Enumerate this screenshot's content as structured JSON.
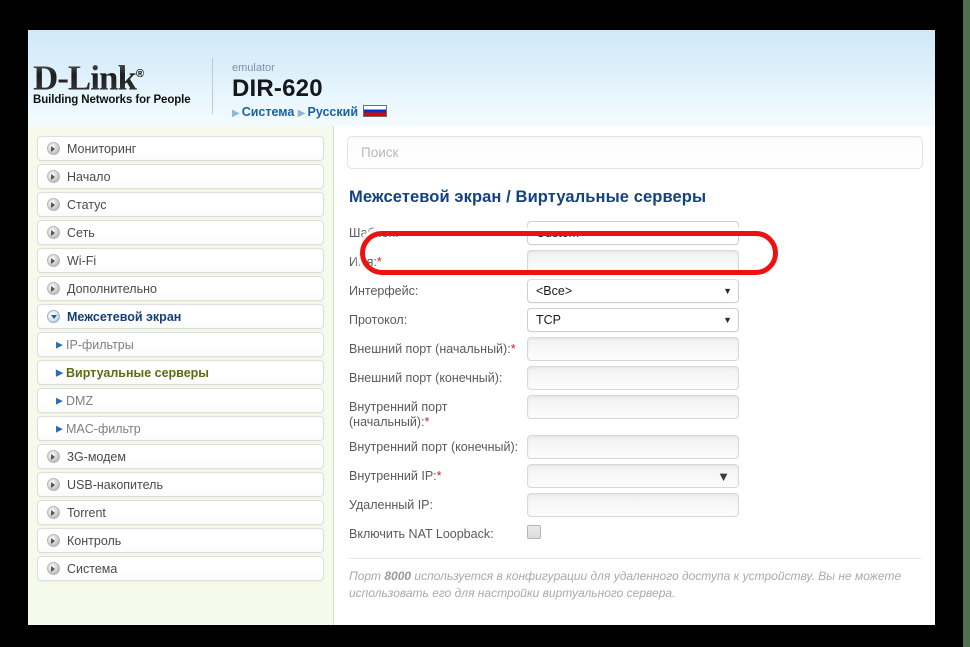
{
  "colors": {
    "accent_blue": "#13427d",
    "highlight_red": "#ee1111",
    "sidebar_bg": "#f6faea",
    "active_green": "#5a6d12",
    "right_edge": "#4d7050"
  },
  "header": {
    "brand": "D-Link",
    "brand_reg": "®",
    "tagline": "Building Networks for People",
    "emulator_label": "emulator",
    "model": "DIR-620",
    "breadcrumbs": [
      {
        "label": "Система"
      },
      {
        "label": "Русский"
      }
    ],
    "flag_name": "ru-flag"
  },
  "sidebar": {
    "items": [
      {
        "label": "Мониторинг",
        "type": "top"
      },
      {
        "label": "Начало",
        "type": "top"
      },
      {
        "label": "Статус",
        "type": "top"
      },
      {
        "label": "Сеть",
        "type": "top"
      },
      {
        "label": "Wi-Fi",
        "type": "top"
      },
      {
        "label": "Дополнительно",
        "type": "top"
      },
      {
        "label": "Межсетевой экран",
        "type": "top-expanded"
      },
      {
        "label": "IP-фильтры",
        "type": "sub"
      },
      {
        "label": "Виртуальные серверы",
        "type": "sub-active"
      },
      {
        "label": "DMZ",
        "type": "sub"
      },
      {
        "label": "MAC-фильтр",
        "type": "sub"
      },
      {
        "label": "3G-модем",
        "type": "top"
      },
      {
        "label": "USB-накопитель",
        "type": "top"
      },
      {
        "label": "Torrent",
        "type": "top"
      },
      {
        "label": "Контроль",
        "type": "top"
      },
      {
        "label": "Система",
        "type": "top"
      }
    ]
  },
  "search": {
    "placeholder": "Поиск",
    "value": ""
  },
  "main": {
    "title": "Межсетевой экран /  Виртуальные серверы",
    "fields": [
      {
        "label": "Шаблон:",
        "required": false,
        "control": "select",
        "value": "Custom"
      },
      {
        "label": "Имя:",
        "required": true,
        "control": "text",
        "value": ""
      },
      {
        "label": "Интерфейс:",
        "required": false,
        "control": "select",
        "value": "<Все>"
      },
      {
        "label": "Протокол:",
        "required": false,
        "control": "select",
        "value": "TCP"
      },
      {
        "label": "Внешний порт (начальный):",
        "required": true,
        "control": "text",
        "value": ""
      },
      {
        "label": "Внешний порт (конечный):",
        "required": false,
        "control": "text",
        "value": ""
      },
      {
        "label": "Внутренний порт (начальный):",
        "required": true,
        "control": "text",
        "value": ""
      },
      {
        "label": "Внутренний порт (конечный):",
        "required": false,
        "control": "text",
        "value": ""
      },
      {
        "label": "Внутренний IP:",
        "required": true,
        "control": "combo",
        "value": ""
      },
      {
        "label": "Удаленный IP:",
        "required": false,
        "control": "text",
        "value": ""
      },
      {
        "label": "Включить NAT Loopback:",
        "required": false,
        "control": "checkbox",
        "value": ""
      }
    ],
    "note_prefix": "Порт ",
    "note_bold": "8000",
    "note_suffix": " используется в конфигурации для удаленного доступа к устройству. Вы не можете использовать его для настройки виртуального сервера."
  },
  "annotation": {
    "name": "red-highlight-template-row"
  }
}
